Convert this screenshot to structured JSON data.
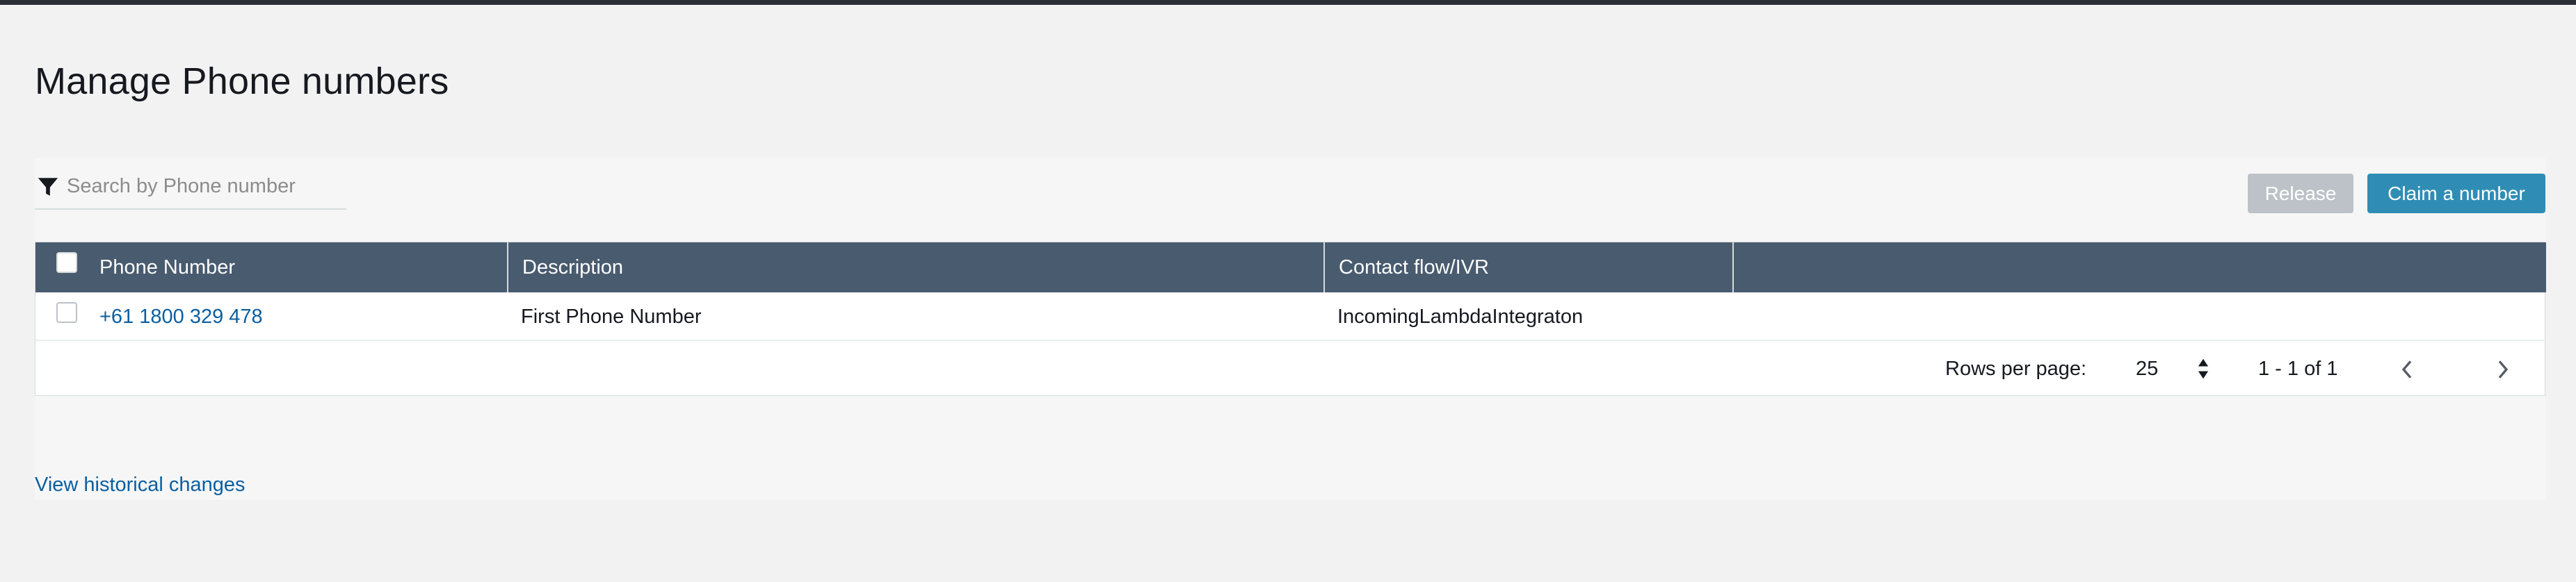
{
  "page": {
    "title": "Manage Phone numbers"
  },
  "search": {
    "placeholder": "Search by Phone number",
    "value": "",
    "icon": "filter-icon"
  },
  "actions": {
    "release_label": "Release",
    "claim_label": "Claim a number",
    "colors": {
      "release_bg": "#bcc2c8",
      "claim_bg": "#2f8db5"
    }
  },
  "table": {
    "columns": [
      "Phone Number",
      "Description",
      "Contact flow/IVR",
      ""
    ],
    "rows": [
      {
        "selected": false,
        "phone": "+61 1800 329 478",
        "description": "First Phone Number",
        "contact_flow": "IncomingLambdaIntegraton"
      }
    ],
    "header_bg": "#495b6f"
  },
  "pagination": {
    "rows_per_page_label": "Rows per page:",
    "rows_per_page": "25",
    "range": "1 - 1 of 1",
    "icons": [
      "sort-icon",
      "chevron-left-icon",
      "chevron-right-icon"
    ]
  },
  "footer": {
    "history_link": "View historical changes"
  }
}
